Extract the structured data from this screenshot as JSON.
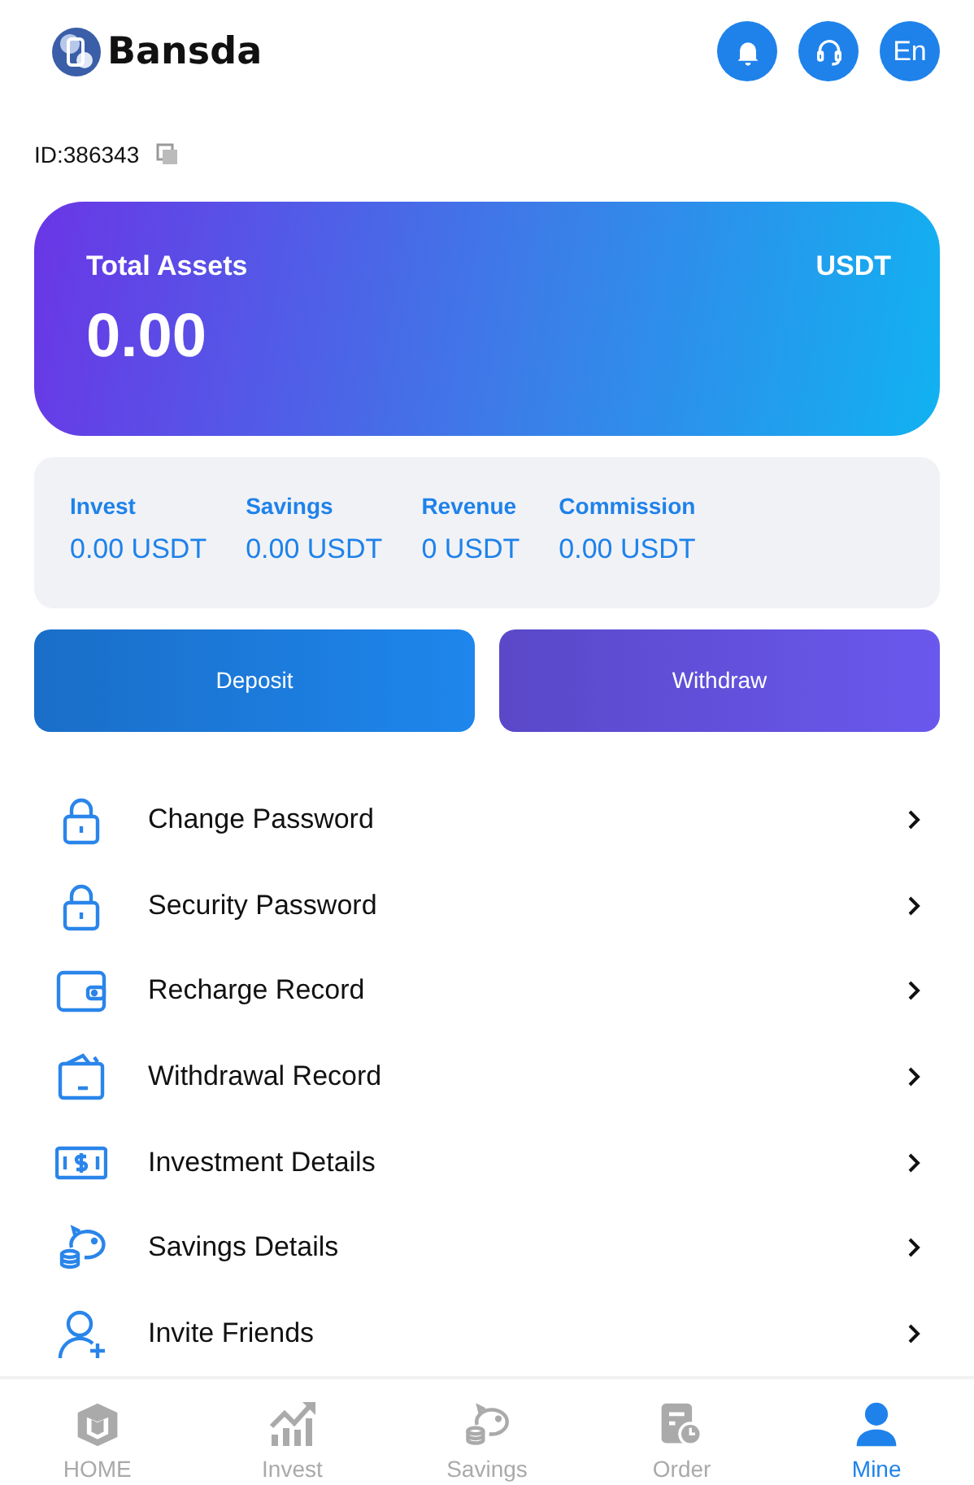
{
  "header": {
    "brand": "Bansda",
    "lang": "En"
  },
  "account": {
    "id": "ID:386343"
  },
  "assets": {
    "title": "Total Assets",
    "currency": "USDT",
    "amount": "0.00"
  },
  "stats": [
    {
      "label": "Invest",
      "value": "0.00 USDT"
    },
    {
      "label": "Savings",
      "value": "0.00 USDT"
    },
    {
      "label": "Revenue",
      "value": "0 USDT"
    },
    {
      "label": "Commission",
      "value": "0.00 USDT"
    }
  ],
  "actions": [
    {
      "kind": "deposit",
      "label": "Deposit"
    },
    {
      "kind": "withdraw",
      "label": "Withdraw"
    }
  ],
  "menu": [
    {
      "kind": "lock",
      "label": "Change Password"
    },
    {
      "kind": "lock",
      "label": "Security Password"
    },
    {
      "kind": "wallet",
      "label": "Recharge Record"
    },
    {
      "kind": "withdrawal",
      "label": "Withdrawal Record"
    },
    {
      "kind": "money",
      "label": "Investment Details"
    },
    {
      "kind": "piggy",
      "label": "Savings Details"
    },
    {
      "kind": "invite",
      "label": "Invite Friends"
    }
  ],
  "tabs": [
    {
      "kind": "home",
      "label": "HOME",
      "selected": false
    },
    {
      "kind": "invest",
      "label": "Invest",
      "selected": false
    },
    {
      "kind": "savings",
      "label": "Savings",
      "selected": false
    },
    {
      "kind": "order",
      "label": "Order",
      "selected": false
    },
    {
      "kind": "mine",
      "label": "Mine",
      "selected": true
    }
  ]
}
